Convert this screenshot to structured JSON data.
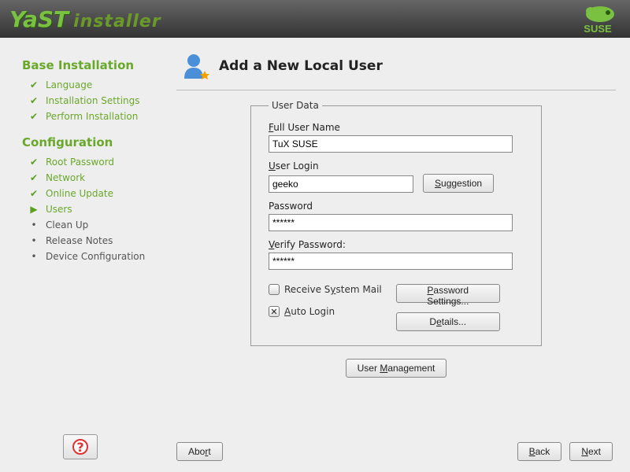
{
  "header": {
    "logo_yast": "YaST",
    "logo_installer": "installer",
    "brand": "SUSE"
  },
  "sidebar": {
    "base_title": "Base Installation",
    "base": [
      {
        "label": "Language",
        "state": "done"
      },
      {
        "label": "Installation Settings",
        "state": "done"
      },
      {
        "label": "Perform Installation",
        "state": "done"
      }
    ],
    "config_title": "Configuration",
    "config": [
      {
        "label": "Root Password",
        "state": "done"
      },
      {
        "label": "Network",
        "state": "done"
      },
      {
        "label": "Online Update",
        "state": "done"
      },
      {
        "label": "Users",
        "state": "current"
      },
      {
        "label": "Clean Up",
        "state": "pending"
      },
      {
        "label": "Release Notes",
        "state": "pending"
      },
      {
        "label": "Device Configuration",
        "state": "pending"
      }
    ]
  },
  "page": {
    "title": "Add a New Local User",
    "fieldset_legend": "User Data",
    "full_name_label": "Full User Name",
    "full_name_value": "TuX SUSE",
    "login_label": "User Login",
    "login_value": "geeko",
    "suggestion_btn": "Suggestion",
    "password_label": "Password",
    "password_value": "******",
    "verify_label": "Verify Password:",
    "verify_value": "******",
    "receive_mail_label": "Receive System Mail",
    "receive_mail_checked": false,
    "auto_login_label": "Auto Login",
    "auto_login_checked": true,
    "password_settings_btn": "Password Settings...",
    "details_btn": "Details...",
    "user_mgmt_btn": "User Management"
  },
  "buttons": {
    "abort": "Abort",
    "back": "Back",
    "next": "Next"
  },
  "colors": {
    "accent": "#6aa82c"
  }
}
